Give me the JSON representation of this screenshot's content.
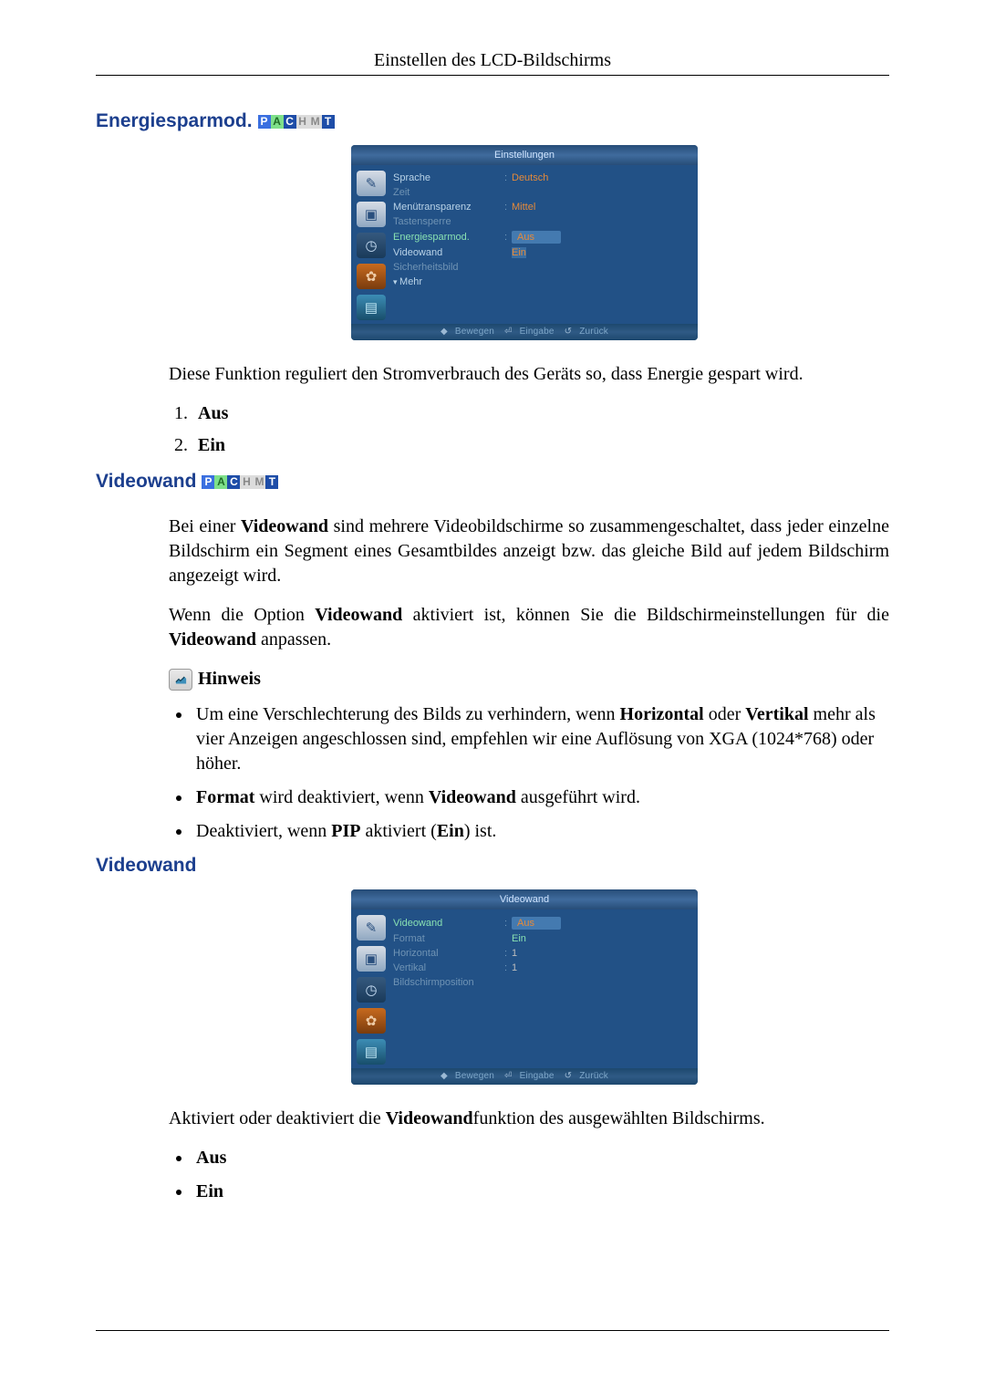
{
  "header": {
    "title": "Einstellen des LCD-Bildschirms"
  },
  "pachmt": {
    "p": "P",
    "a": "A",
    "c": "C",
    "h": "H",
    "m": "M",
    "t": "T"
  },
  "section1": {
    "heading": "Energiesparmod.",
    "osd": {
      "title": "Einstellungen",
      "rows": {
        "sprache": {
          "k": "Sprache",
          "v": "Deutsch"
        },
        "zeit": {
          "k": "Zeit"
        },
        "transparenz": {
          "k": "Menütransparenz",
          "v": "Mittel"
        },
        "tastensperre": {
          "k": "Tastensperre"
        },
        "energiesparmod": {
          "k": "Energiesparmod.",
          "v": "Aus",
          "v2": "Ein"
        },
        "videowand": {
          "k": "Videowand"
        },
        "sicherheitsbild": {
          "k": "Sicherheitsbild"
        },
        "mehr": {
          "k": "Mehr"
        }
      },
      "footer": {
        "move": "Bewegen",
        "enter": "Eingabe",
        "back": "Zurück"
      }
    },
    "body": {
      "p1": "Diese Funktion reguliert den Stromverbrauch des Geräts so, dass Energie gespart wird.",
      "li1": "Aus",
      "li2": "Ein"
    }
  },
  "section2": {
    "heading": "Videowand",
    "body": {
      "p1a": "Bei einer ",
      "p1b": "Videowand",
      "p1c": " sind mehrere Videobildschirme so zusammengeschaltet, dass jeder einzelne Bildschirm ein Segment eines Gesamtbildes anzeigt bzw. das gleiche Bild auf jedem Bildschirm angezeigt wird.",
      "p2a": "Wenn die Option ",
      "p2b": "Videowand",
      "p2c": " aktiviert ist, können Sie die Bildschirmeinstellungen für die ",
      "p2d": "Videowand",
      "p2e": " anpassen.",
      "hinweis": "Hinweis",
      "b1a": "Um eine Verschlechterung des Bilds zu verhindern, wenn ",
      "b1b": "Horizontal",
      "b1c": " oder ",
      "b1d": "Vertikal",
      "b1e": " mehr als vier Anzeigen angeschlossen sind, empfehlen wir eine Auflösung von XGA (1024*768) oder höher.",
      "b2a": "Format",
      "b2b": " wird deaktiviert, wenn ",
      "b2c": "Videowand",
      "b2d": " ausgeführt wird.",
      "b3a": "Deaktiviert, wenn ",
      "b3b": "PIP",
      "b3c": " aktiviert (",
      "b3d": "Ein",
      "b3e": ") ist."
    }
  },
  "section3": {
    "heading": "Videowand",
    "osd": {
      "title": "Videowand",
      "rows": {
        "videowand": {
          "k": "Videowand",
          "v": "Aus",
          "v2": "Ein"
        },
        "format": {
          "k": "Format"
        },
        "horizontal": {
          "k": "Horizontal",
          "v": "1"
        },
        "vertikal": {
          "k": "Vertikal",
          "v": "1"
        },
        "position": {
          "k": "Bildschirmposition"
        }
      },
      "footer": {
        "move": "Bewegen",
        "enter": "Eingabe",
        "back": "Zurück"
      }
    },
    "body": {
      "p1a": "Aktiviert oder deaktiviert die ",
      "p1b": "Videowand",
      "p1c": "funktion des ausgewählten Bildschirms.",
      "li1": "Aus",
      "li2": "Ein"
    }
  }
}
